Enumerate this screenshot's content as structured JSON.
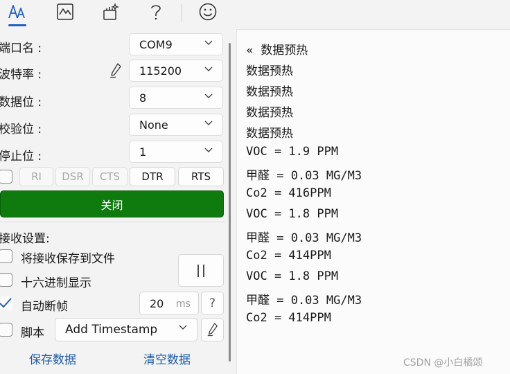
{
  "toolbar": {
    "icons": [
      "text-style-icon",
      "chart-icon",
      "magic-wand-icon",
      "help-icon",
      "smiley-icon"
    ],
    "accent": "#1f5fbf"
  },
  "serial": {
    "port_label": "端口名 :",
    "port_value": "COM9",
    "baud_label": "波特率 :",
    "baud_value": "115200",
    "databits_label": "数据位 :",
    "databits_value": "8",
    "parity_label": "校验位 :",
    "parity_value": "None",
    "stopbits_label": "停止位 :",
    "stopbits_value": "1"
  },
  "signals": {
    "ri": "RI",
    "dsr": "DSR",
    "cts": "CTS",
    "dtr": "DTR",
    "rts": "RTS"
  },
  "close_button": {
    "label": "关闭",
    "color": "#0f7b0f"
  },
  "receive": {
    "title": "接收设置:",
    "save_to_file": "将接收保存到文件",
    "save_to_file_checked": false,
    "hex_display": "十六进制显示",
    "hex_display_checked": false,
    "auto_frame": "自动断帧",
    "auto_frame_checked": true,
    "auto_frame_value": "20",
    "auto_frame_unit": "ms",
    "help": "?",
    "script": "脚本",
    "script_checked": false,
    "script_option": "Add Timestamp",
    "save_data": "保存数据",
    "clear_data": "清空数据"
  },
  "log": {
    "lines": [
      "«  数据预热",
      "数据预热",
      "数据预热",
      "数据预热",
      "数据预热",
      "VOC = 1.9 PPM",
      "甲醛 = 0.03 MG/M3",
      "Co2 = 416PPM",
      "VOC = 1.8 PPM",
      "甲醛 = 0.03 MG/M3",
      "Co2 = 414PPM",
      "VOC = 1.8 PPM",
      "甲醛 = 0.03 MG/M3",
      "Co2 = 414PPM"
    ]
  },
  "watermark": "CSDN @小白橘颂"
}
